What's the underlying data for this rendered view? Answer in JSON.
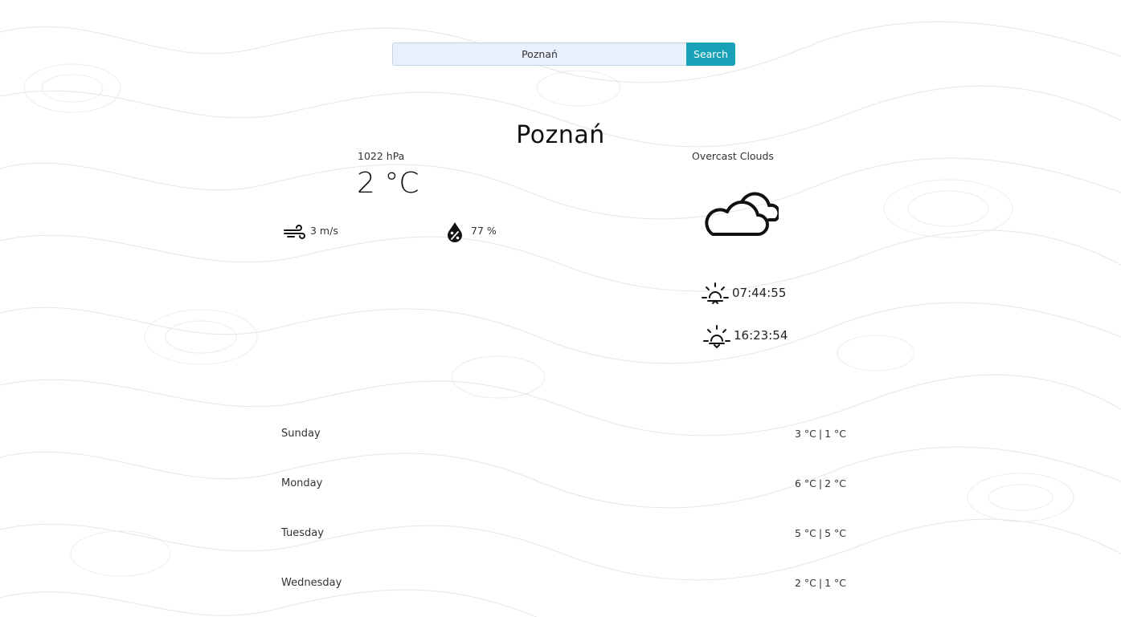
{
  "search": {
    "value": "Poznań",
    "button_label": "Search"
  },
  "current": {
    "city": "Poznań",
    "pressure": "1022 hPa",
    "temperature": "2 °C",
    "wind": "3 m/s",
    "humidity": "77 %",
    "condition": "Overcast Clouds",
    "sunrise": "07:44:55",
    "sunset": "16:23:54"
  },
  "icons": {
    "wind": "wind-icon",
    "humidity": "humidity-drop-icon",
    "condition": "cloud-icon",
    "sunrise": "sunrise-icon",
    "sunset": "sunset-icon"
  },
  "forecast": [
    {
      "day": "Sunday",
      "max": "3 °C",
      "min": "1 °C"
    },
    {
      "day": "Monday",
      "max": "6 °C",
      "min": "2 °C"
    },
    {
      "day": "Tuesday",
      "max": "5 °C",
      "min": "5 °C"
    },
    {
      "day": "Wednesday",
      "max": "2 °C",
      "min": "1 °C"
    }
  ],
  "colors": {
    "accent": "#17a2b8",
    "input_bg": "#e8f0fe"
  }
}
